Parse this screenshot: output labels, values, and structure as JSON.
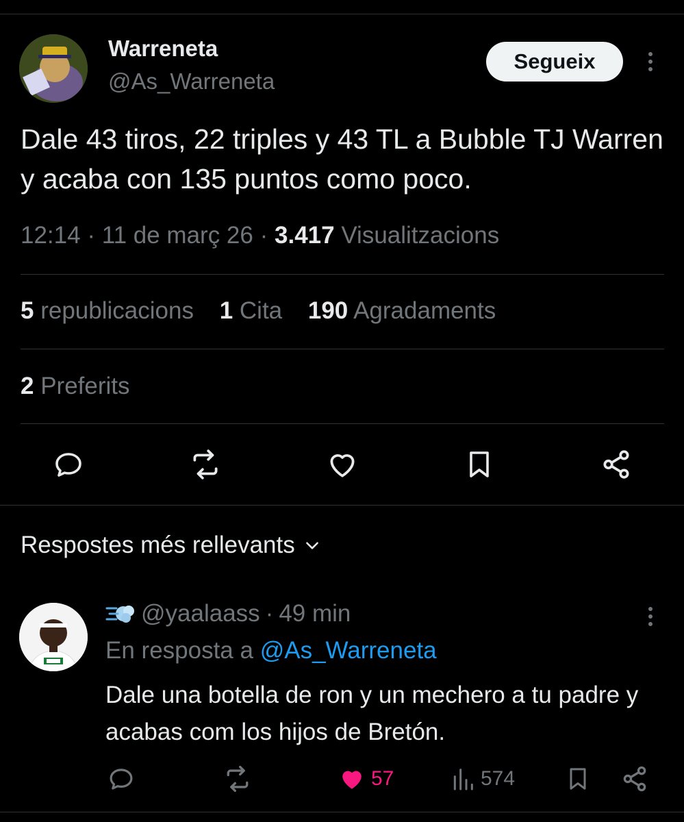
{
  "tweet": {
    "author_name": "Warreneta",
    "author_handle": "@As_Warreneta",
    "follow_label": "Segueix",
    "text": "Dale 43 tiros, 22 triples y 43 TL a Bubble TJ Warren y acaba con 135 puntos como poco.",
    "time": "12:14",
    "date": "11 de març 26",
    "views_count": "3.417",
    "views_label": "Visualitzacions",
    "reposts_count": "5",
    "reposts_label": "republicacions",
    "quotes_count": "1",
    "quotes_label": "Cita",
    "likes_count": "190",
    "likes_label": "Agradaments",
    "bookmarks_count": "2",
    "bookmarks_label": "Preferits"
  },
  "replies_section": {
    "sort_label": "Respostes més rellevants"
  },
  "reply": {
    "handle": "@yaalaass",
    "time_ago": "49 min",
    "reply_prefix": "En resposta a",
    "reply_to": "@As_Warreneta",
    "text": "Dale una botella de ron y un mechero a tu padre y acabas com los hijos de Bretón.",
    "likes": "57",
    "views": "574",
    "liked": true
  },
  "colors": {
    "background": "#000000",
    "text_primary": "#e7e9ea",
    "text_secondary": "#71767b",
    "accent_blue": "#1d9bf0",
    "like_pink": "#f91880",
    "divider": "#2f3336"
  },
  "icons": {
    "reply": "reply-icon",
    "repost": "repost-icon",
    "like": "heart-icon",
    "bookmark": "bookmark-icon",
    "share": "share-icon",
    "views": "views-icon",
    "more": "more-icon",
    "chevron": "chevron-down-icon",
    "emoji_badge": "dash-emoji-icon"
  }
}
